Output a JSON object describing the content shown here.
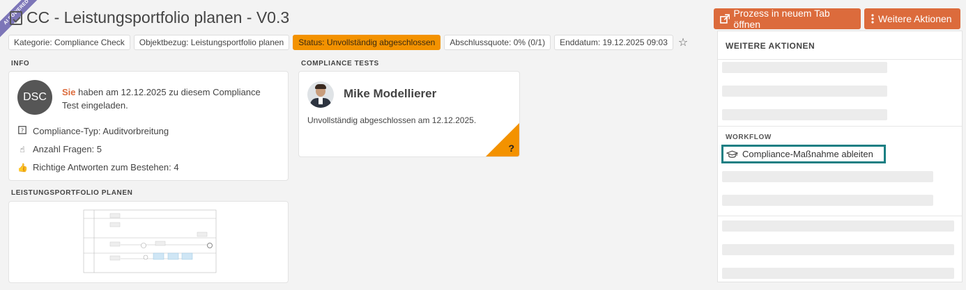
{
  "ribbon": "AI POWERED",
  "header": {
    "title": "CC - Leistungsportfolio planen - V0.3",
    "title_icon": "check-square-icon",
    "btn_open": "Prozess in neuem Tab öffnen",
    "btn_more": "Weitere Aktionen"
  },
  "tags": {
    "kategorie": "Kategorie: Compliance Check",
    "objektbezug": "Objektbezug: Leistungsportfolio planen",
    "status": "Status: Unvollständig abgeschlossen",
    "quote": "Abschlussquote: 0% (0/1)",
    "enddatum": "Enddatum: 19.12.2025 09:03"
  },
  "info": {
    "label": "INFO",
    "avatar": "DSC",
    "invite_you": "Sie",
    "invite_rest": " haben am 12.12.2025 zu diesem Compliance Test eingeladen.",
    "type": "Compliance-Typ: Auditvorbreitung",
    "questions": "Anzahl Fragen: 5",
    "correct": "Richtige Antworten zum Bestehen: 4"
  },
  "tests": {
    "label": "COMPLIANCE TESTS",
    "person": "Mike Modellierer",
    "status": "Unvollständig abgeschlossen am 12.12.2025.",
    "corner": "?"
  },
  "diagram": {
    "label": "LEISTUNGSPORTFOLIO PLANEN"
  },
  "dropdown": {
    "title": "WEITERE AKTIONEN",
    "workflow_label": "WORKFLOW",
    "workflow_item": "Compliance-Maßnahme ableiten",
    "workflow_icon": "graduation-cap-icon"
  },
  "colors": {
    "accent": "#dc6b3c",
    "status": "#f39200",
    "focus": "#1a7f83"
  }
}
